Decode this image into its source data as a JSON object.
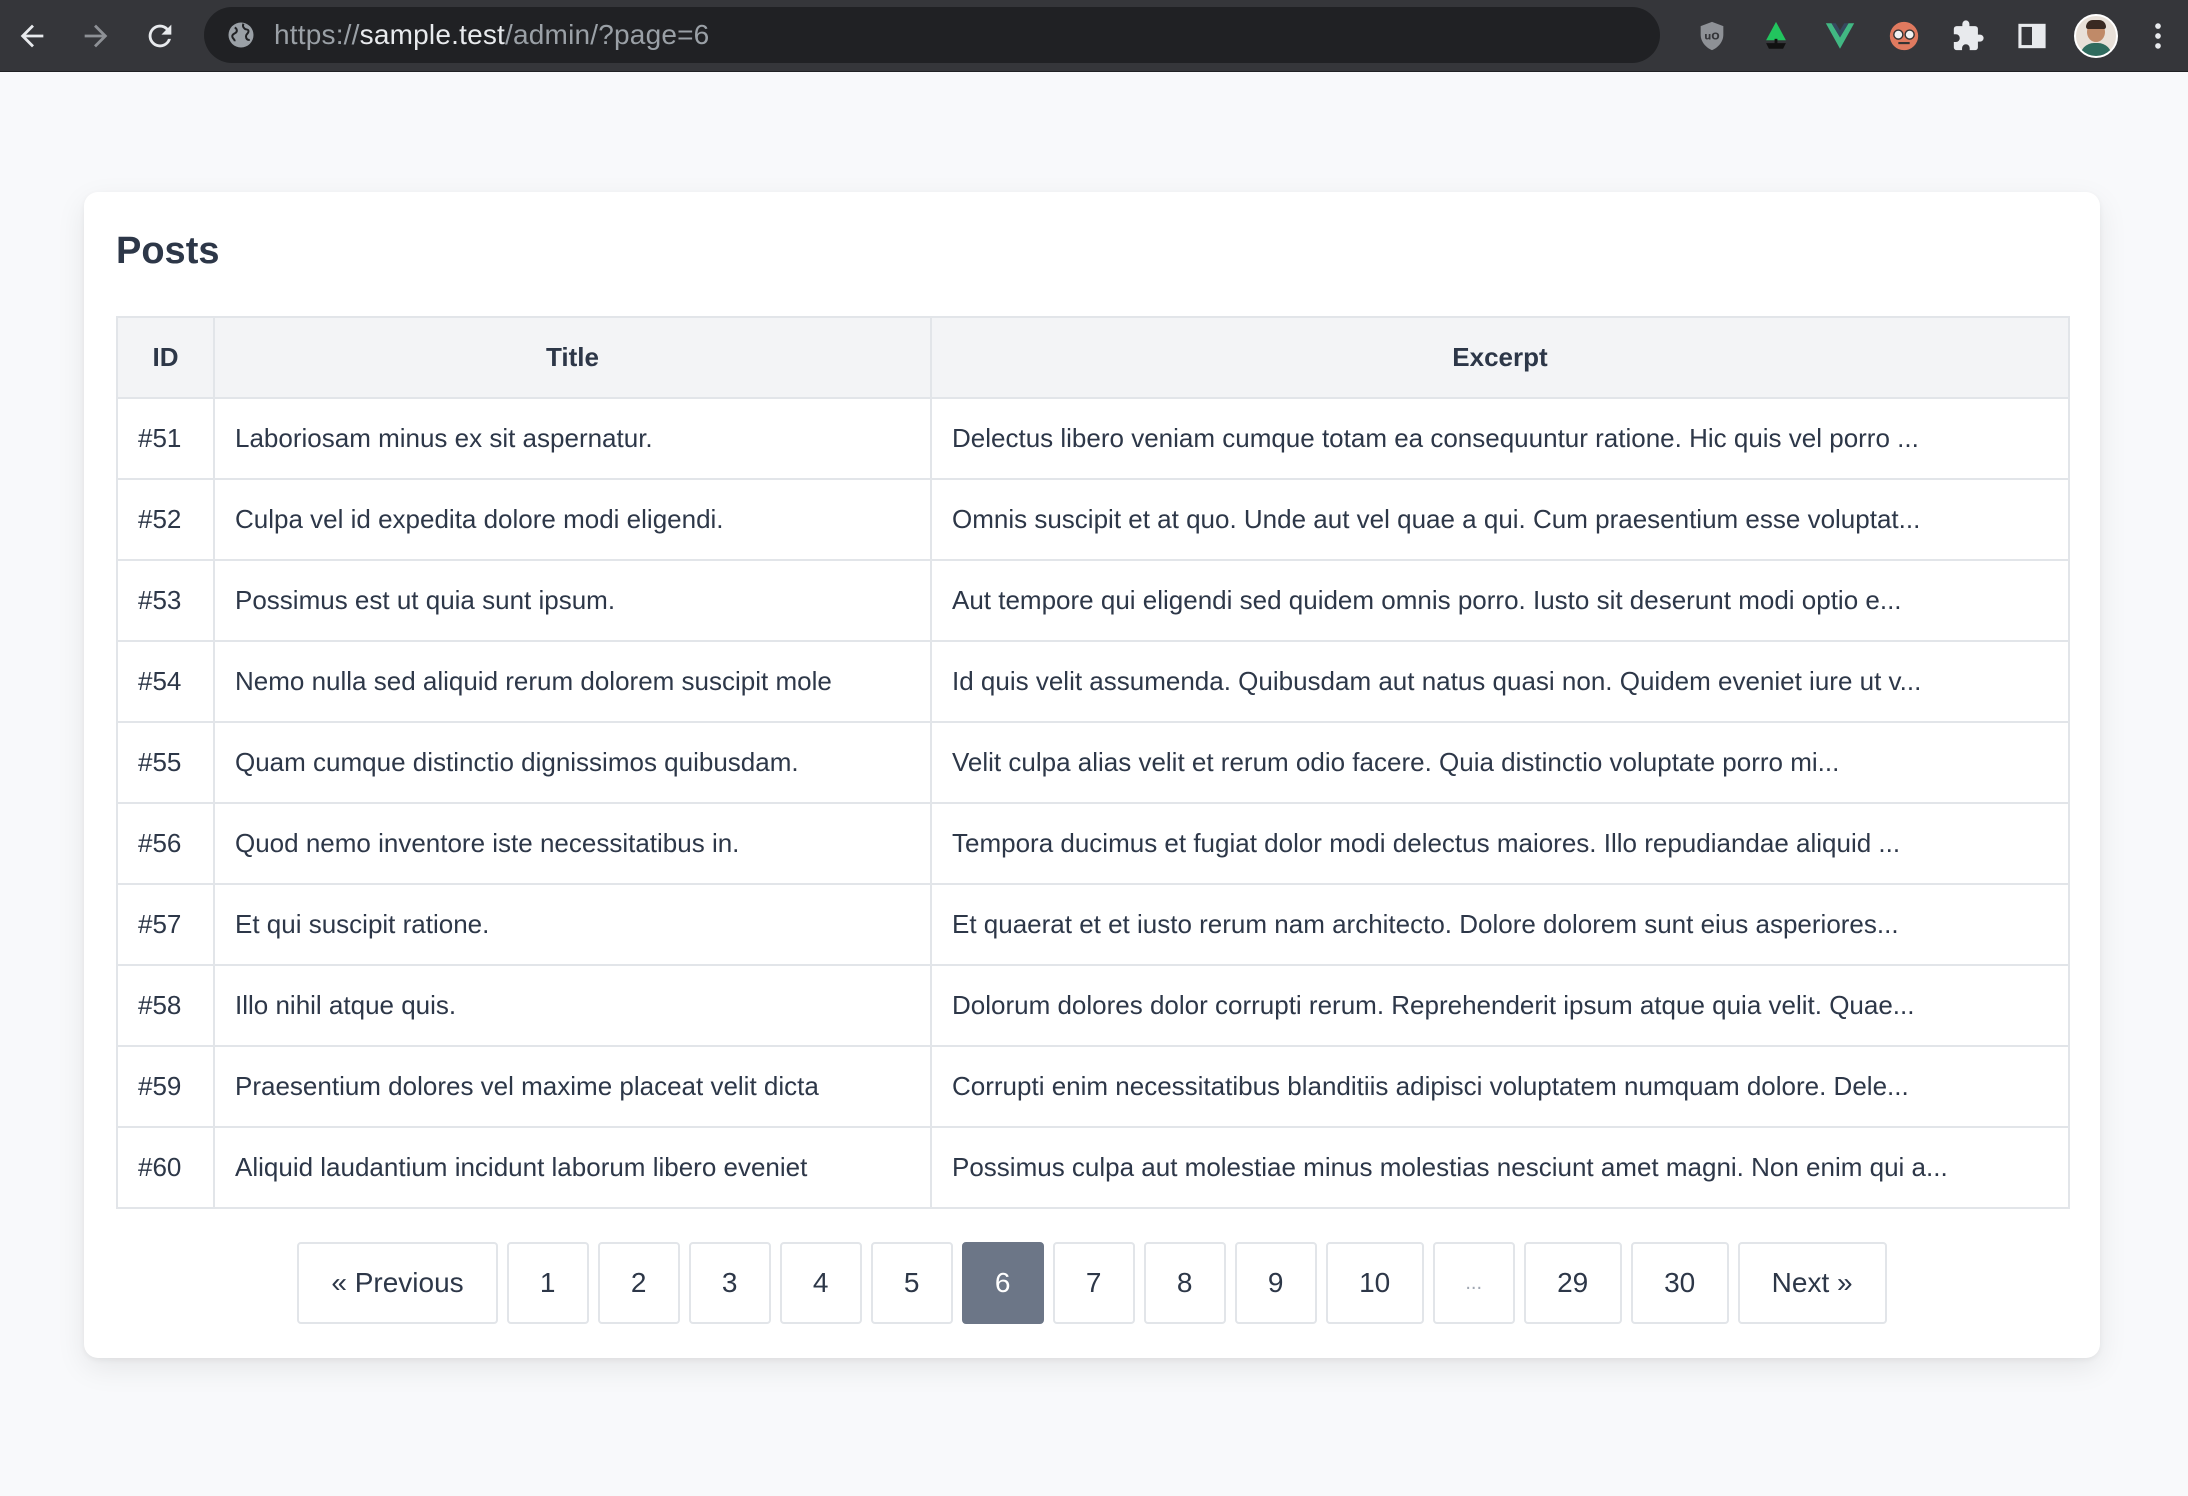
{
  "browser": {
    "url_scheme": "https://",
    "url_host": "sample.test",
    "url_path": "/admin/?page=6",
    "extensions": [
      "ublock-icon",
      "green-tree-icon",
      "vue-devtools-icon",
      "reviewer-icon",
      "puzzle-icon",
      "side-panel-icon"
    ],
    "colors": {
      "toolbar": "#35363a",
      "omnibox": "#202124"
    }
  },
  "page": {
    "title": "Posts",
    "table": {
      "headers": {
        "id": "ID",
        "title": "Title",
        "excerpt": "Excerpt"
      },
      "rows": [
        {
          "id": "#51",
          "title": "Laboriosam minus ex sit aspernatur.",
          "excerpt": "Delectus libero veniam cumque totam ea consequuntur ratione. Hic quis vel porro ..."
        },
        {
          "id": "#52",
          "title": "Culpa vel id expedita dolore modi eligendi.",
          "excerpt": "Omnis suscipit et at quo. Unde aut vel quae a qui. Cum praesentium esse voluptat..."
        },
        {
          "id": "#53",
          "title": "Possimus est ut quia sunt ipsum.",
          "excerpt": "Aut tempore qui eligendi sed quidem omnis porro. Iusto sit deserunt modi optio e..."
        },
        {
          "id": "#54",
          "title": "Nemo nulla sed aliquid rerum dolorem suscipit mole",
          "excerpt": "Id quis velit assumenda. Quibusdam aut natus quasi non. Quidem eveniet iure ut v..."
        },
        {
          "id": "#55",
          "title": "Quam cumque distinctio dignissimos quibusdam.",
          "excerpt": "Velit culpa alias velit et rerum odio facere. Quia distinctio voluptate porro mi..."
        },
        {
          "id": "#56",
          "title": "Quod nemo inventore iste necessitatibus in.",
          "excerpt": "Tempora ducimus et fugiat dolor modi delectus maiores. Illo repudiandae aliquid ..."
        },
        {
          "id": "#57",
          "title": "Et qui suscipit ratione.",
          "excerpt": "Et quaerat et et iusto rerum nam architecto. Dolore dolorem sunt eius asperiores..."
        },
        {
          "id": "#58",
          "title": "Illo nihil atque quis.",
          "excerpt": "Dolorum dolores dolor corrupti rerum. Reprehenderit ipsum atque quia velit. Quae..."
        },
        {
          "id": "#59",
          "title": "Praesentium dolores vel maxime placeat velit dicta",
          "excerpt": "Corrupti enim necessitatibus blanditiis adipisci voluptatem numquam dolore. Dele..."
        },
        {
          "id": "#60",
          "title": "Aliquid laudantium incidunt laborum libero eveniet",
          "excerpt": "Possimus culpa aut molestiae minus molestias nesciunt amet magni. Non enim qui a..."
        }
      ]
    },
    "pagination": {
      "previous": "« Previous",
      "next": "Next »",
      "pages": [
        "1",
        "2",
        "3",
        "4",
        "5",
        "6",
        "7",
        "8",
        "9",
        "10",
        "...",
        "29",
        "30"
      ],
      "current": "6",
      "active_color": "#6c7687"
    }
  }
}
